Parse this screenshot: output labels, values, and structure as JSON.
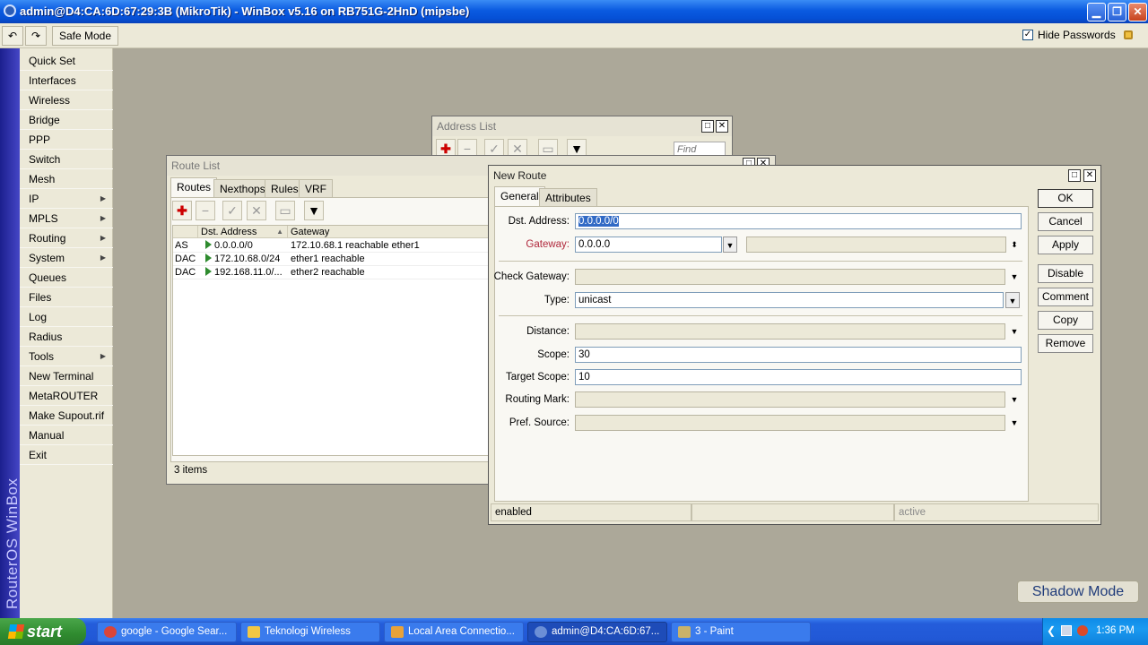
{
  "app": {
    "title": "admin@D4:CA:6D:67:29:3B (MikroTik) - WinBox v5.16 on RB751G-2HnD (mipsbe)"
  },
  "toolbar": {
    "undo_icon": "undo-icon",
    "redo_icon": "redo-icon",
    "safe_mode_label": "Safe Mode",
    "hide_passwords_label": "Hide Passwords",
    "hide_passwords_checked": true
  },
  "sidebar": {
    "brand": "RouterOS WinBox",
    "items": [
      {
        "label": "Quick Set",
        "arrow": false
      },
      {
        "label": "Interfaces",
        "arrow": false
      },
      {
        "label": "Wireless",
        "arrow": false
      },
      {
        "label": "Bridge",
        "arrow": false
      },
      {
        "label": "PPP",
        "arrow": false
      },
      {
        "label": "Switch",
        "arrow": false
      },
      {
        "label": "Mesh",
        "arrow": false
      },
      {
        "label": "IP",
        "arrow": true
      },
      {
        "label": "MPLS",
        "arrow": true
      },
      {
        "label": "Routing",
        "arrow": true
      },
      {
        "label": "System",
        "arrow": true
      },
      {
        "label": "Queues",
        "arrow": false
      },
      {
        "label": "Files",
        "arrow": false
      },
      {
        "label": "Log",
        "arrow": false
      },
      {
        "label": "Radius",
        "arrow": false
      },
      {
        "label": "Tools",
        "arrow": true
      },
      {
        "label": "New Terminal",
        "arrow": false
      },
      {
        "label": "MetaROUTER",
        "arrow": false
      },
      {
        "label": "Make Supout.rif",
        "arrow": false
      },
      {
        "label": "Manual",
        "arrow": false
      },
      {
        "label": "Exit",
        "arrow": false
      }
    ]
  },
  "address_list": {
    "title": "Address List",
    "find_placeholder": "Find"
  },
  "route_list": {
    "title": "Route List",
    "tabs": [
      "Routes",
      "Nexthops",
      "Rules",
      "VRF"
    ],
    "columns": [
      "Dst. Address",
      "Gateway"
    ],
    "rows": [
      {
        "flags": "AS",
        "dst": "0.0.0.0/0",
        "gateway": "172.10.68.1 reachable ether1"
      },
      {
        "flags": "DAC",
        "dst": "172.10.68.0/24",
        "gateway": "ether1 reachable"
      },
      {
        "flags": "DAC",
        "dst": "192.168.11.0/...",
        "gateway": "ether2 reachable"
      }
    ],
    "status": "3 items"
  },
  "new_route": {
    "title": "New Route",
    "tabs": [
      "General",
      "Attributes"
    ],
    "fields": {
      "dst_address": {
        "label": "Dst. Address:",
        "value": "0.0.0.0/0"
      },
      "gateway": {
        "label": "Gateway:",
        "value": "0.0.0.0"
      },
      "check_gateway": {
        "label": "Check Gateway:",
        "value": ""
      },
      "type": {
        "label": "Type:",
        "value": "unicast"
      },
      "distance": {
        "label": "Distance:",
        "value": ""
      },
      "scope": {
        "label": "Scope:",
        "value": "30"
      },
      "target_scope": {
        "label": "Target Scope:",
        "value": "10"
      },
      "routing_mark": {
        "label": "Routing Mark:",
        "value": ""
      },
      "pref_source": {
        "label": "Pref. Source:",
        "value": ""
      }
    },
    "buttons": [
      "OK",
      "Cancel",
      "Apply",
      "Disable",
      "Comment",
      "Copy",
      "Remove"
    ],
    "status": {
      "left": "enabled",
      "middle": "",
      "right": "active"
    }
  },
  "shadow_mode_label": "Shadow Mode",
  "taskbar": {
    "start_label": "start",
    "tasks": [
      {
        "label": "google - Google Sear...",
        "icon": "chrome-icon",
        "color": "#d9453a"
      },
      {
        "label": "Teknologi Wireless",
        "icon": "folder-icon",
        "color": "#f2c744"
      },
      {
        "label": "Local Area Connectio...",
        "icon": "network-icon",
        "color": "#e8a23a"
      },
      {
        "label": "admin@D4:CA:6D:67...",
        "icon": "winbox-icon",
        "color": "#6b8fd6"
      },
      {
        "label": "3 - Paint",
        "icon": "paint-icon",
        "color": "#c9b26a"
      }
    ],
    "clock": "1:36 PM"
  }
}
